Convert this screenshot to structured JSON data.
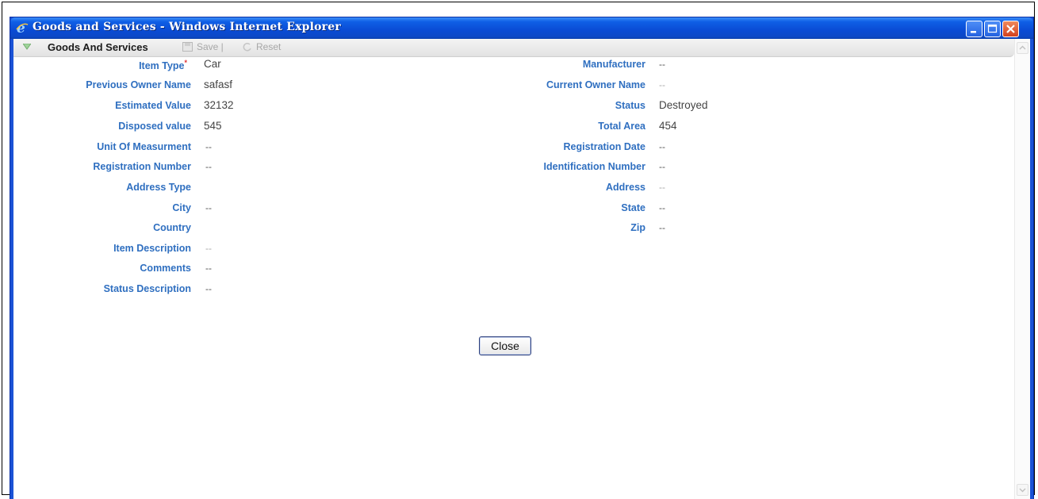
{
  "window": {
    "title": "Goods and Services - Windows Internet Explorer"
  },
  "toolbar": {
    "section_title": "Goods And Services",
    "save_label": "Save |",
    "reset_label": "Reset"
  },
  "left_fields": [
    {
      "label": "Item Type",
      "required_mark": "*",
      "value": "Car"
    },
    {
      "label": "Previous Owner Name",
      "value": "safasf"
    },
    {
      "label": "Estimated Value",
      "value": "32132"
    },
    {
      "label": "Disposed value",
      "value": "545"
    },
    {
      "label": "Unit Of Measurment",
      "value": "--"
    },
    {
      "label": "Registration Number",
      "value": "--"
    },
    {
      "label": "Address Type",
      "value": ""
    },
    {
      "label": "City",
      "value": "--"
    },
    {
      "label": "Country",
      "value": ""
    },
    {
      "label": "Item Description",
      "value": "--"
    },
    {
      "label": "Comments",
      "value": "--"
    },
    {
      "label": "Status Description",
      "value": "--"
    }
  ],
  "right_fields": [
    {
      "label": "Manufacturer",
      "value": "--"
    },
    {
      "label": "Current Owner Name",
      "value": "--"
    },
    {
      "label": "Status",
      "value": "Destroyed"
    },
    {
      "label": "Total Area",
      "value": "454"
    },
    {
      "label": "Registration Date",
      "value": "--"
    },
    {
      "label": "Identification Number",
      "value": "--"
    },
    {
      "label": "Address",
      "value": "--"
    },
    {
      "label": "State",
      "value": "--"
    },
    {
      "label": "Zip",
      "value": "--"
    }
  ],
  "buttons": {
    "close_label": "Close"
  },
  "icons": {
    "app": "ie-logo-icon",
    "collapse": "triangle-down-icon",
    "save": "save-disk-icon",
    "reset": "reset-icon"
  },
  "colors": {
    "title_bar": "#0a4bd4",
    "label_blue": "#2f6fc0",
    "close_red": "#d2401e"
  }
}
